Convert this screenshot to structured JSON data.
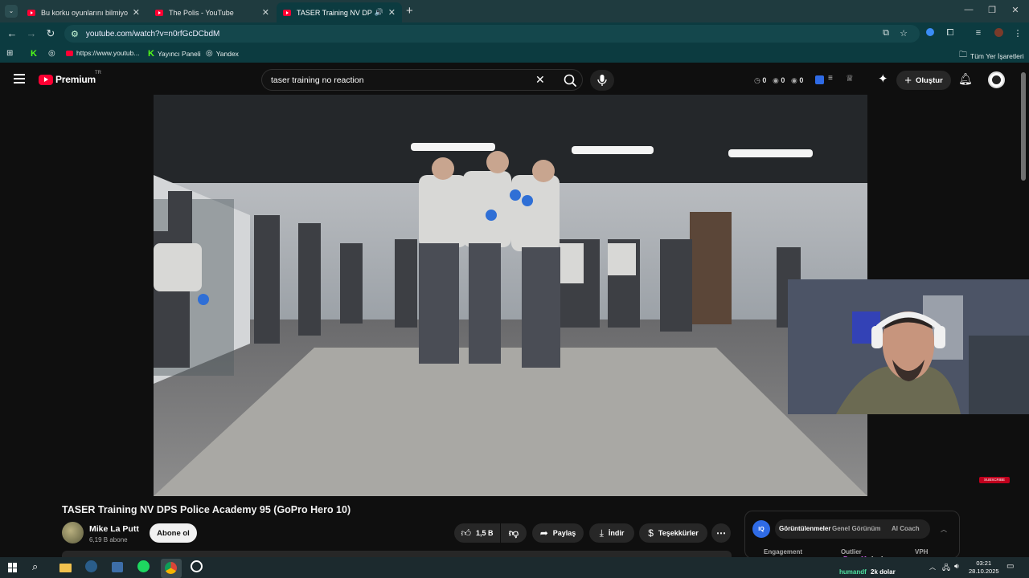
{
  "browser": {
    "tabs": [
      {
        "title": "Bu korku oyunlarını bilmiyorsan",
        "active": false
      },
      {
        "title": "The Polis - YouTube",
        "active": false
      },
      {
        "title": "TASER Training NV DPS Poli",
        "active": true
      }
    ],
    "url": "youtube.com/watch?v=n0rfGcDCbdM",
    "bookmarks": [
      "https://www.youtub...",
      "Yayıncı Paneli",
      "Yandex"
    ],
    "all_bookmarks": "Tüm Yer İşaretleri"
  },
  "youtube": {
    "logo_text": "Premium",
    "region": "TR",
    "search_query": "taser training no reaction",
    "header_stats": [
      "0",
      "0",
      "0"
    ],
    "create_label": "Oluştur"
  },
  "video": {
    "title": "TASER Training NV DPS Police Academy 95 (GoPro Hero 10)",
    "channel": "Mike La Putt",
    "subscribers": "6,19 B abone",
    "subscribe_label": "Abone ol",
    "likes": "1,5 B",
    "share_label": "Paylaş",
    "download_label": "İndir",
    "thanks_label": "Teşekkürler",
    "player_badge": "SUBSCRIBE"
  },
  "extension": {
    "logo": "IQ",
    "tabs": [
      "Görüntülenmeler",
      "Genel Görünüm",
      "AI Coach"
    ],
    "columns": [
      "Engagement",
      "Outlier",
      "VPH"
    ]
  },
  "chat_overlay": [
    {
      "user": "pavyonFares11",
      "message": "bedava",
      "user_color": "#d563f0"
    },
    {
      "user": "humandf",
      "message": "2k dolar",
      "user_color": "#4fe0a0"
    }
  ],
  "taskbar": {
    "time": "03:21",
    "date": "28.10.2025"
  }
}
